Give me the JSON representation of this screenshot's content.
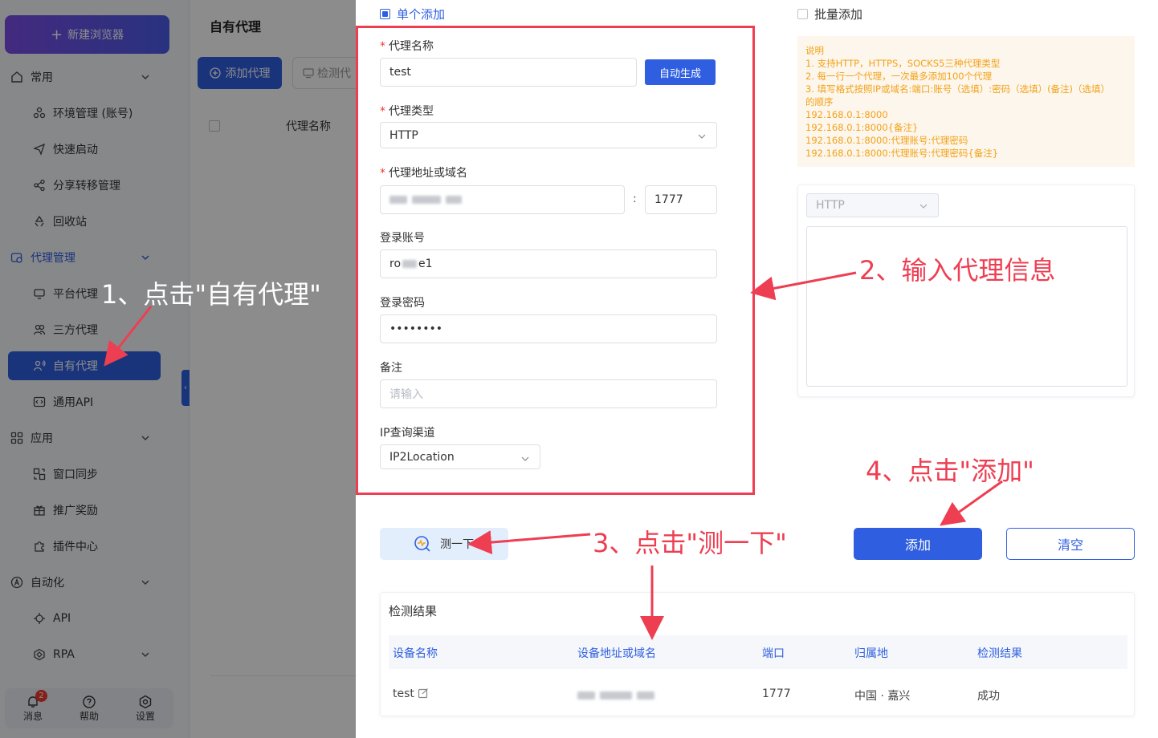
{
  "sidebar": {
    "new_browser": "新建浏览器",
    "groups": {
      "common": "常用",
      "proxy": "代理管理",
      "apps": "应用",
      "automation": "自动化"
    },
    "items": {
      "env": "环境管理 (账号)",
      "quick": "快速启动",
      "share": "分享转移管理",
      "recycle": "回收站",
      "platform_proxy": "平台代理",
      "third_proxy": "三方代理",
      "own_proxy": "自有代理",
      "general_api": "通用API",
      "window_sync": "窗口同步",
      "promo": "推广奖励",
      "plugins": "插件中心",
      "api": "API",
      "rpa": "RPA"
    },
    "bottom": {
      "messages": "消息",
      "messages_badge": "2",
      "help": "帮助",
      "settings": "设置"
    }
  },
  "list_page": {
    "title": "自有代理",
    "add_button": "添加代理",
    "check_button": "检测代",
    "column_name": "代理名称"
  },
  "drawer": {
    "mode_single": "单个添加",
    "mode_bulk": "批量添加",
    "form": {
      "name_label": "代理名称",
      "name_value": "test",
      "auto_button": "自动生成",
      "type_label": "代理类型",
      "type_value": "HTTP",
      "host_label": "代理地址或域名",
      "port_value": "1777",
      "account_label": "登录账号",
      "account_prefix": "ro",
      "account_suffix": "e1",
      "password_label": "登录密码",
      "password_value": "••••••••",
      "remark_label": "备注",
      "remark_placeholder": "请输入",
      "ip_channel_label": "IP查询渠道",
      "ip_channel_value": "IP2Location"
    },
    "notice": {
      "lines": [
        "说明",
        "1. 支持HTTP，HTTPS，SOCKS5三种代理类型",
        "2. 每一行一个代理，一次最多添加100个代理",
        "3. 填写格式按照IP或域名:端口:账号（选填）:密码（选填）(备注)（选填）",
        "的顺序",
        "192.168.0.1:8000",
        "192.168.0.1:8000{备注}",
        "192.168.0.1:8000:代理账号:代理密码",
        "192.168.0.1:8000:代理账号:代理密码{备注}"
      ]
    },
    "bulk_type": "HTTP",
    "test_button": "测一下",
    "submit_button": "添加",
    "clear_button": "清空",
    "result": {
      "title": "检测结果",
      "columns": [
        "设备名称",
        "设备地址或域名",
        "端口",
        "归属地",
        "检测结果"
      ],
      "row": {
        "name": "test",
        "port": "1777",
        "location": "中国 · 嘉兴",
        "status": "成功"
      }
    }
  },
  "annotations": {
    "step1": "1、点击\"自有代理\"",
    "step2": "2、输入代理信息",
    "step3": "3、点击\"测一下\"",
    "step4": "4、点击\"添加\""
  },
  "colors": {
    "primary": "#2f5fe0",
    "annotation": "#ee3e52",
    "notice_text": "#f2a219"
  }
}
